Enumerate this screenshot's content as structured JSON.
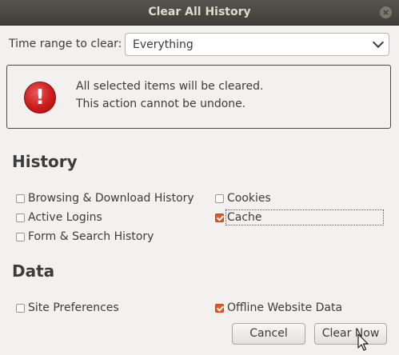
{
  "window": {
    "title": "Clear All History",
    "close_glyph": "×"
  },
  "time_range": {
    "label": "Time range to clear:",
    "value": "Everything"
  },
  "warning": {
    "line1": "All selected items will be cleared.",
    "line2": "This action cannot be undone."
  },
  "history": {
    "heading": "History",
    "items": [
      {
        "label": "Browsing & Download History",
        "checked": false
      },
      {
        "label": "Cookies",
        "checked": false
      },
      {
        "label": "Active Logins",
        "checked": false
      },
      {
        "label": "Cache",
        "checked": true
      },
      {
        "label": "Form & Search History",
        "checked": false
      }
    ]
  },
  "data": {
    "heading": "Data",
    "items": [
      {
        "label": "Site Preferences",
        "checked": false
      },
      {
        "label": "Offline Website Data",
        "checked": true
      }
    ]
  },
  "buttons": {
    "cancel": "Cancel",
    "clear_now": "Clear Now"
  },
  "colors": {
    "checkbox_accent": "#e4571f",
    "titlebar": "#3f3e3a"
  }
}
